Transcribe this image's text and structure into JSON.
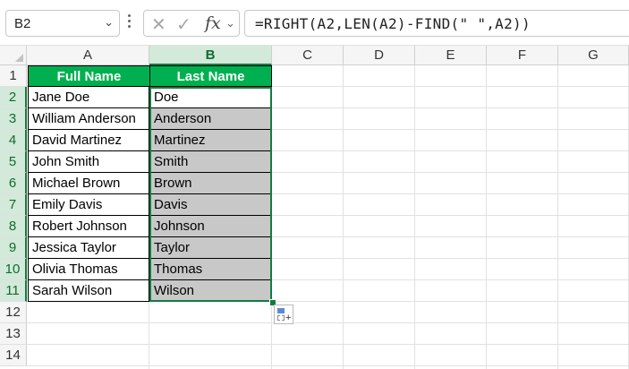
{
  "formula_bar": {
    "name_box": "B2",
    "formula": "=RIGHT(A2,LEN(A2)-FIND(\" \",A2))"
  },
  "columns": [
    "A",
    "B",
    "C",
    "D",
    "E",
    "F",
    "G"
  ],
  "rows": [
    "1",
    "2",
    "3",
    "4",
    "5",
    "6",
    "7",
    "8",
    "9",
    "10",
    "11",
    "12",
    "13",
    "14"
  ],
  "table": {
    "headers": [
      "Full Name",
      "Last Name"
    ],
    "header_color": "#00b050",
    "data": [
      [
        "Jane Doe",
        "Doe"
      ],
      [
        "William Anderson",
        "Anderson"
      ],
      [
        "David Martinez",
        "Martinez"
      ],
      [
        "John Smith",
        "Smith"
      ],
      [
        "Michael Brown",
        "Brown"
      ],
      [
        "Emily Davis",
        "Davis"
      ],
      [
        "Robert Johnson",
        "Johnson"
      ],
      [
        "Jessica Taylor",
        "Taylor"
      ],
      [
        "Olivia Thomas",
        "Thomas"
      ],
      [
        "Sarah Wilson",
        "Wilson"
      ]
    ]
  },
  "selection": {
    "active_cell": "B2",
    "range": "B2:B11",
    "color": "#107c41"
  },
  "icons": {
    "name_box_dropdown": "chevron-down-icon",
    "cancel": "cancel-x-icon",
    "enter": "checkmark-icon",
    "insert_function": "fx-icon",
    "quick_analysis": "quick-analysis-icon"
  }
}
